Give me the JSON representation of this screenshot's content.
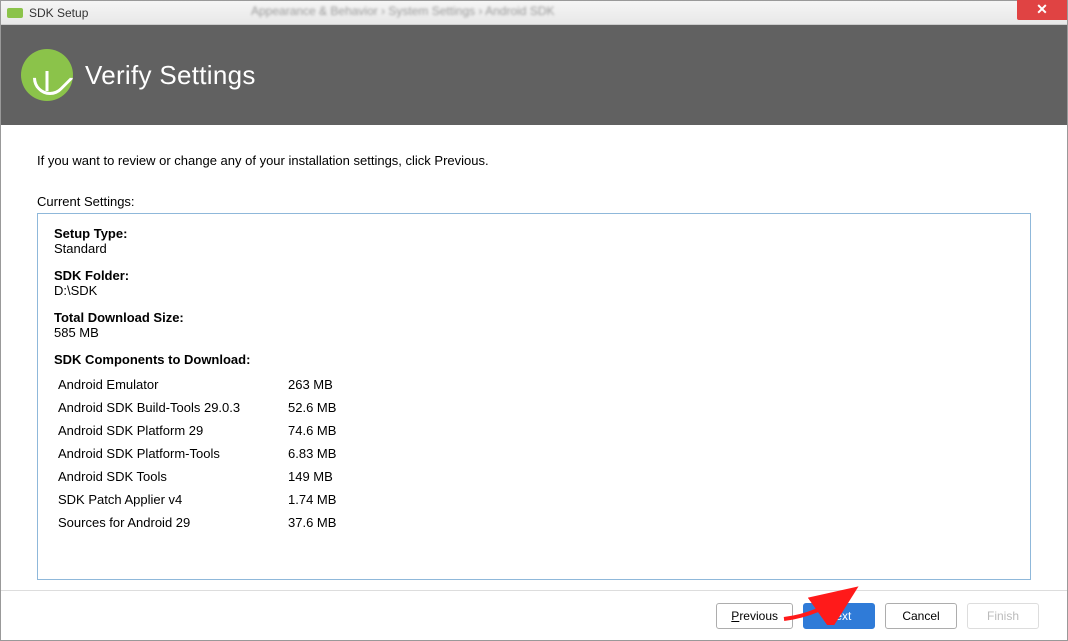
{
  "titlebar": {
    "title": "SDK Setup",
    "blurred_text": "Appearance & Behavior  ›  System Settings  ›  Android SDK"
  },
  "header": {
    "title": "Verify Settings"
  },
  "content": {
    "instruction": "If you want to review or change any of your installation settings, click Previous.",
    "current_settings_label": "Current Settings:",
    "setup_type_label": "Setup Type:",
    "setup_type_value": "Standard",
    "sdk_folder_label": "SDK Folder:",
    "sdk_folder_value": "D:\\SDK",
    "download_size_label": "Total Download Size:",
    "download_size_value": "585 MB",
    "components_label": "SDK Components to Download:",
    "components": [
      {
        "name": "Android Emulator",
        "size": "263 MB"
      },
      {
        "name": "Android SDK Build-Tools 29.0.3",
        "size": "52.6 MB"
      },
      {
        "name": "Android SDK Platform 29",
        "size": "74.6 MB"
      },
      {
        "name": "Android SDK Platform-Tools",
        "size": "6.83 MB"
      },
      {
        "name": "Android SDK Tools",
        "size": "149 MB"
      },
      {
        "name": "SDK Patch Applier v4",
        "size": "1.74 MB"
      },
      {
        "name": "Sources for Android 29",
        "size": "37.6 MB"
      }
    ]
  },
  "footer": {
    "previous": "Previous",
    "next": "Next",
    "cancel": "Cancel",
    "finish": "Finish"
  }
}
